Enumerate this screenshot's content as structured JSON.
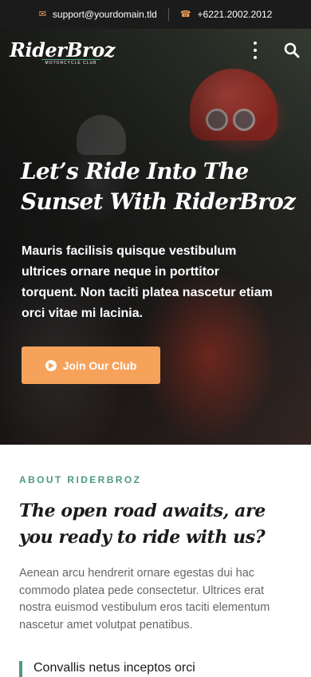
{
  "topbar": {
    "email": "support@yourdomain.tld",
    "phone": "+6221.2002.2012",
    "email_icon": "envelope-icon",
    "phone_icon": "phone-icon"
  },
  "brand": {
    "name": "RiderBroz",
    "tagline": "MOTORCYCLE CLUB"
  },
  "header": {
    "menu_icon": "kebab-menu-icon",
    "search_icon": "search-icon"
  },
  "hero": {
    "title": "Let’s Ride Into The Sunset With RiderBroz",
    "text": "Mauris facilisis quisque vestibulum ultrices ornare neque in porttitor torquent. Non taciti platea nascetur etiam orci vitae mi lacinia.",
    "cta_label": "Join Our Club",
    "cta_icon": "play-circle-icon"
  },
  "about": {
    "eyebrow": "ABOUT RIDERBROZ",
    "title": "The open road awaits, are you ready to ride with us?",
    "text": "Aenean arcu hendrerit ornare egestas dui hac commodo platea pede consectetur. Ultrices erat nostra euismod vestibulum eros taciti elementum nascetur amet volutpat penatibus.",
    "quote": "Convallis netus inceptos orci"
  },
  "colors": {
    "accent_orange": "#f6a25b",
    "accent_green": "#4d9a83",
    "topbar_bg": "#1b1b1b"
  }
}
